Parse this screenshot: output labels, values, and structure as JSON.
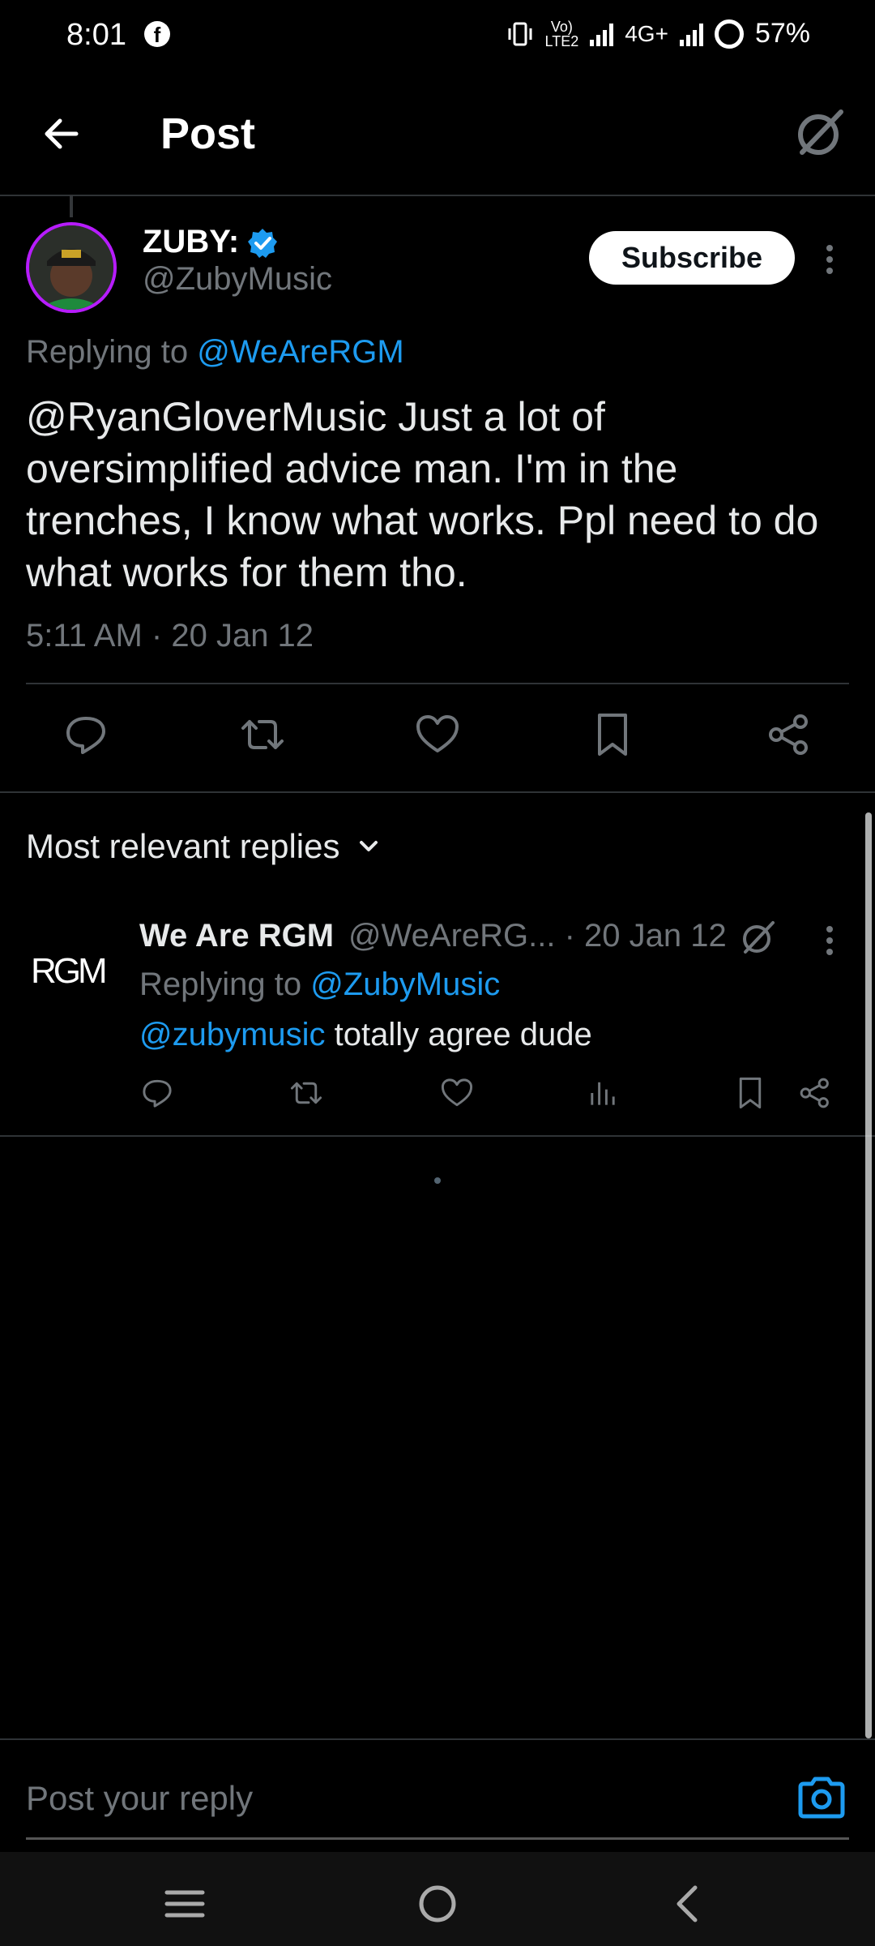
{
  "status_bar": {
    "time": "8:01",
    "app_icon": "facebook-icon",
    "volte": "Vo)",
    "lte": "LTE2",
    "network": "4G+",
    "battery": "57%"
  },
  "header": {
    "title": "Post",
    "back_icon": "arrow-left-icon",
    "grok_icon": "grok-icon"
  },
  "tweet": {
    "author_name": "ZUBY:",
    "author_handle": "@ZubyMusic",
    "subscribe_label": "Subscribe",
    "replying_prefix": "Replying to",
    "replying_to": "@WeAreRGM",
    "text": "@RyanGloverMusic Just a lot of oversimplified advice man. I'm in the trenches, I know what works. Ppl need to do what works for them tho.",
    "timestamp": "5:11 AM · 20 Jan 12",
    "actions": [
      "reply-icon",
      "repost-icon",
      "like-icon",
      "bookmark-icon",
      "share-icon"
    ]
  },
  "replies_section": {
    "sort_label": "Most relevant replies"
  },
  "reply": {
    "logo_text": "RGM",
    "name": "We Are RGM",
    "handle_date": "@WeAreRG... · 20 Jan 12",
    "replying_prefix": "Replying to",
    "replying_to": "@ZubyMusic",
    "mention": "@zubymusic",
    "text": " totally agree dude",
    "actions": [
      "reply-icon",
      "repost-icon",
      "like-icon",
      "views-icon",
      "bookmark-icon",
      "share-icon"
    ]
  },
  "composer": {
    "placeholder": "Post your reply",
    "camera_icon": "camera-icon"
  },
  "nav_bar": {
    "items": [
      "menu-icon",
      "home-icon",
      "back-icon"
    ]
  },
  "colors": {
    "background": "#000000",
    "link": "#1d9bf0",
    "secondary_text": "#71767b",
    "divider": "#2f3336",
    "verified": "#1d9bf0",
    "avatar_ring": "#b71cff"
  }
}
